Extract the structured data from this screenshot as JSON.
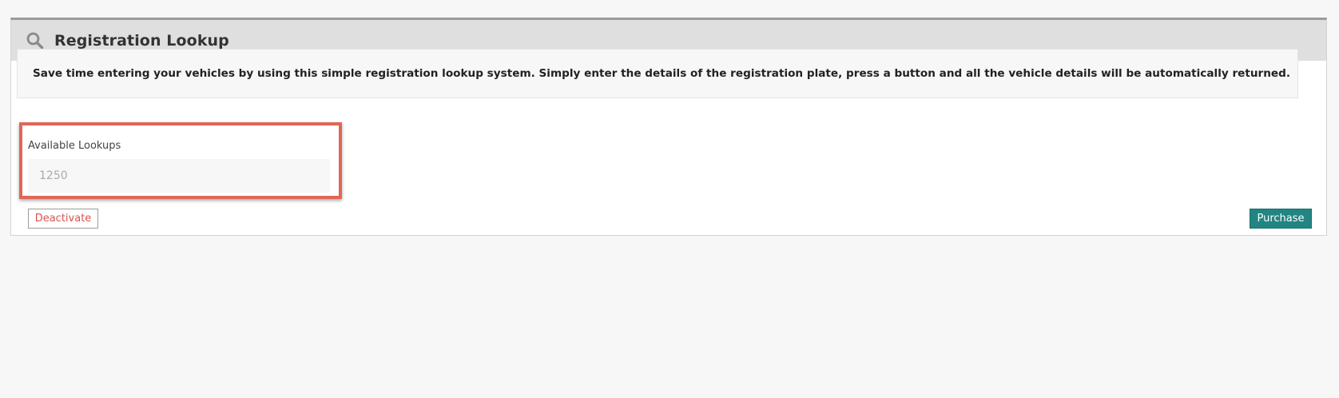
{
  "panel": {
    "title": "Registration Lookup",
    "icon": "search-icon"
  },
  "info": {
    "text": "Save time entering your vehicles by using this simple registration lookup system. Simply enter the details of the registration plate, press a button and all the vehicle details will be automatically returned."
  },
  "lookups": {
    "label": "Available Lookups",
    "value": "1250"
  },
  "actions": {
    "deactivate_label": "Deactivate",
    "purchase_label": "Purchase"
  },
  "colors": {
    "highlight_border": "#e06757",
    "purchase_bg": "#228582",
    "deactivate_text": "#d9534f",
    "header_bg": "#dfdfdf"
  }
}
